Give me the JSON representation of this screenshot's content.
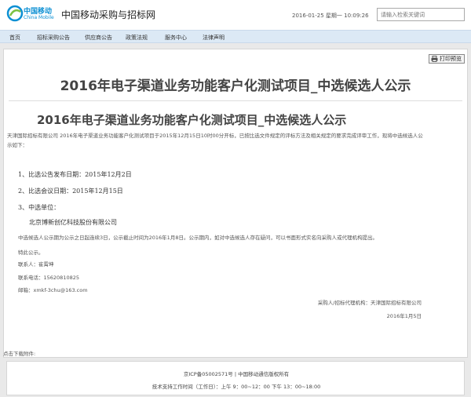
{
  "header": {
    "logo_cn": "中国移动",
    "logo_en": "China Mobile",
    "site_title": "中国移动采购与招标网",
    "datetime": "2016-01-25 星期一 10:09:26",
    "search_placeholder": "请输入检索关键词"
  },
  "nav": {
    "items": [
      {
        "label": "首页"
      },
      {
        "label": "招标采购公告"
      },
      {
        "label": "供应商公告"
      },
      {
        "label": "政策法规"
      },
      {
        "label": "服务中心"
      },
      {
        "label": "法律声明"
      }
    ]
  },
  "toolbar": {
    "print_label": "打印预览"
  },
  "article": {
    "title": "2016年电子渠道业务功能客户化测试项目_中选候选人公示",
    "subtitle": "2016年电子渠道业务功能客户化测试项目_中选候选人公示",
    "intro": "天津国际招标有限公司 2016年电子渠道业务功能客户化测试项目于2015年12月15日10时00分开标，已按比选文件规定的评标方法及相关规定的要求完成评审工作，现将中选候选人公示如下：",
    "items": [
      "1、比选公告发布日期：2015年12月2日",
      "2、比选会议日期：2015年12月15日",
      "3、中选单位："
    ],
    "company": "北京博新创亿科技股份有限公司",
    "notice": "中选候选人公示期为公示之日起连续3日，公示截止时间为2016年1月8日。公示期内，如对中选候选人存在疑问，可以书面形式实名向采购人或代理机构提出。",
    "closing": "特此公示。",
    "contact_person": "联系人：崔霄坤",
    "contact_phone": "联系电话：15620810825",
    "contact_email": "邮箱：xmkf-3chu@163.com",
    "signature": "采购人/招标代理机构：天津国际招标有限公司",
    "date": "2016年1月5日"
  },
  "attachments": {
    "label": "点击下载附件:"
  },
  "footer": {
    "line1": "京ICP备05002571号 | 中国移动通信版权所有",
    "line2": "技术支持工作时间（工作日）：上午 9：00~12：00 下午 13：00~18:00"
  },
  "colors": {
    "brand": "#0b8fd3",
    "nav_bg": "#dce9f5",
    "page_bg": "#e9e9e9"
  }
}
